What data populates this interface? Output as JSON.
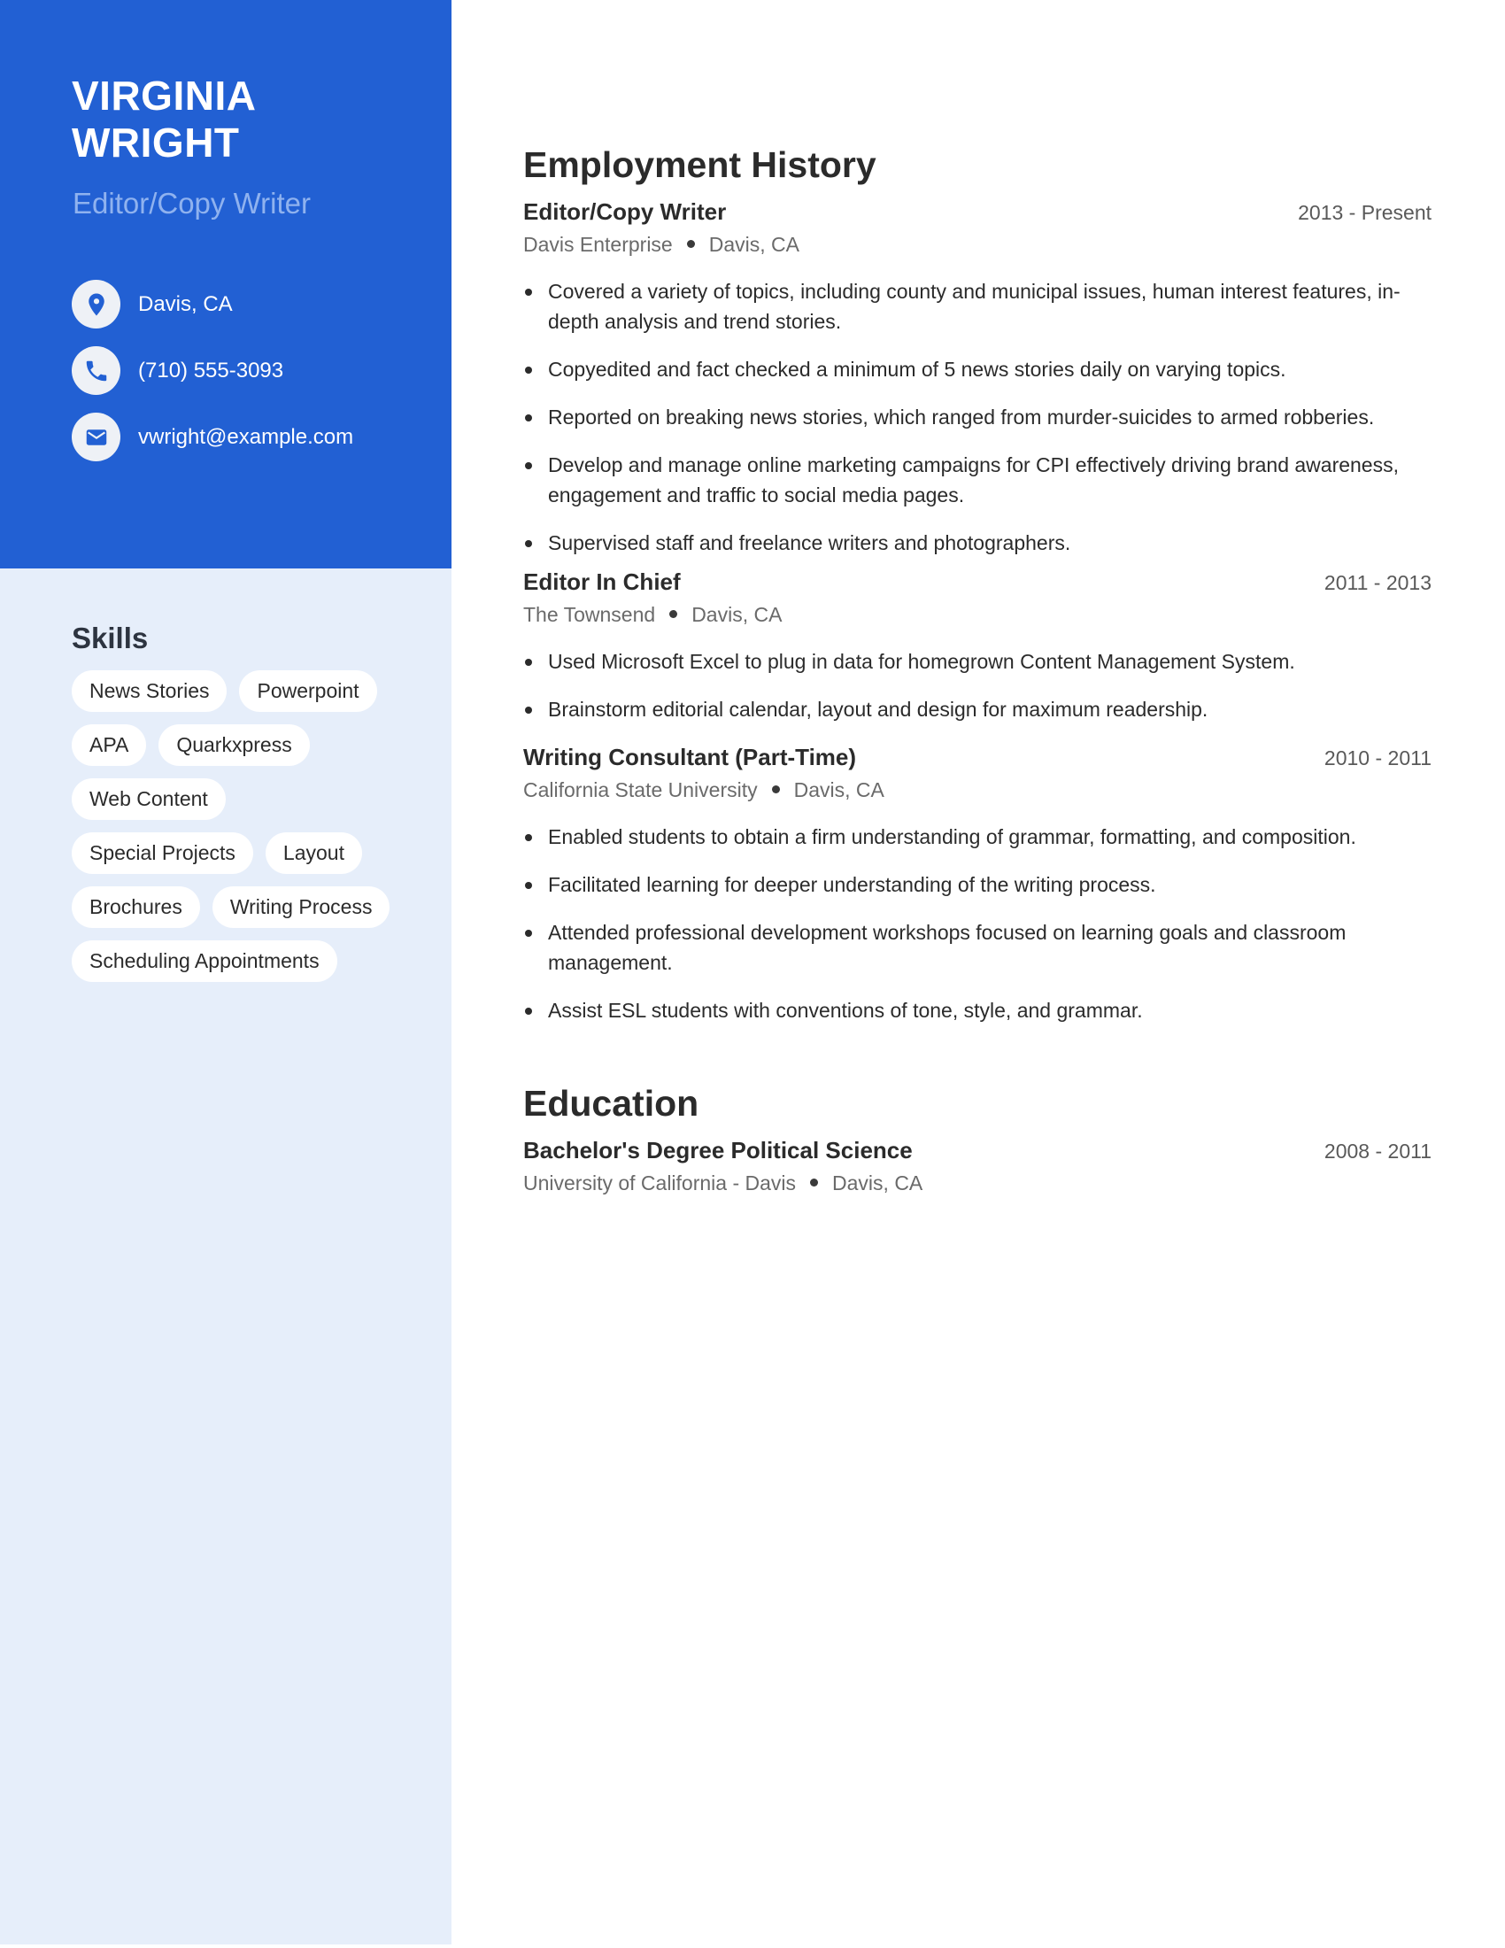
{
  "profile": {
    "name_line1": "VIRGINIA",
    "name_line2": "WRIGHT",
    "title": "Editor/Copy Writer",
    "colors": {
      "accent": "#2260d3",
      "sidebar_bg": "#e6eefa",
      "title_color": "#8fb2ef"
    }
  },
  "contacts": [
    {
      "icon": "location-pin-icon",
      "text": "Davis, CA"
    },
    {
      "icon": "phone-icon",
      "text": "(710) 555-3093"
    },
    {
      "icon": "envelope-icon",
      "text": "vwright@example.com"
    }
  ],
  "skills": {
    "title": "Skills",
    "items": [
      "News Stories",
      "Powerpoint",
      "APA",
      "Quarkxpress",
      "Web Content",
      "Special Projects",
      "Layout",
      "Brochures",
      "Writing Process",
      "Scheduling Appointments"
    ]
  },
  "employment": {
    "title": "Employment History",
    "jobs": [
      {
        "title": "Editor/Copy Writer",
        "dates": "2013 - Present",
        "company": "Davis Enterprise",
        "location": "Davis, CA",
        "bullets": [
          "Covered a variety of topics, including county and municipal issues, human interest features, in-depth analysis and trend stories.",
          "Copyedited and fact checked a minimum of 5 news stories daily on varying topics.",
          "Reported on breaking news stories, which ranged from murder-suicides to armed robberies.",
          "Develop and manage online marketing campaigns for CPI effectively driving brand awareness, engagement and traffic to social media pages.",
          "Supervised staff and freelance writers and photographers."
        ]
      },
      {
        "title": "Editor In Chief",
        "dates": "2011 - 2013",
        "company": "The Townsend",
        "location": "Davis, CA",
        "bullets": [
          "Used Microsoft Excel to plug in data for homegrown Content Management System.",
          "Brainstorm editorial calendar, layout and design for maximum readership."
        ]
      },
      {
        "title": "Writing Consultant (Part-Time)",
        "dates": "2010 - 2011",
        "company": "California State University",
        "location": "Davis, CA",
        "bullets": [
          "Enabled students to obtain a firm understanding of grammar, formatting, and composition.",
          "Facilitated learning for deeper understanding of the writing process.",
          "Attended professional development workshops focused on learning goals and classroom management.",
          "Assist ESL students with conventions of tone, style, and grammar."
        ]
      }
    ]
  },
  "education": {
    "title": "Education",
    "items": [
      {
        "degree": "Bachelor's Degree Political Science",
        "dates": "2008 - 2011",
        "school": "University of California - Davis",
        "location": "Davis, CA"
      }
    ]
  }
}
